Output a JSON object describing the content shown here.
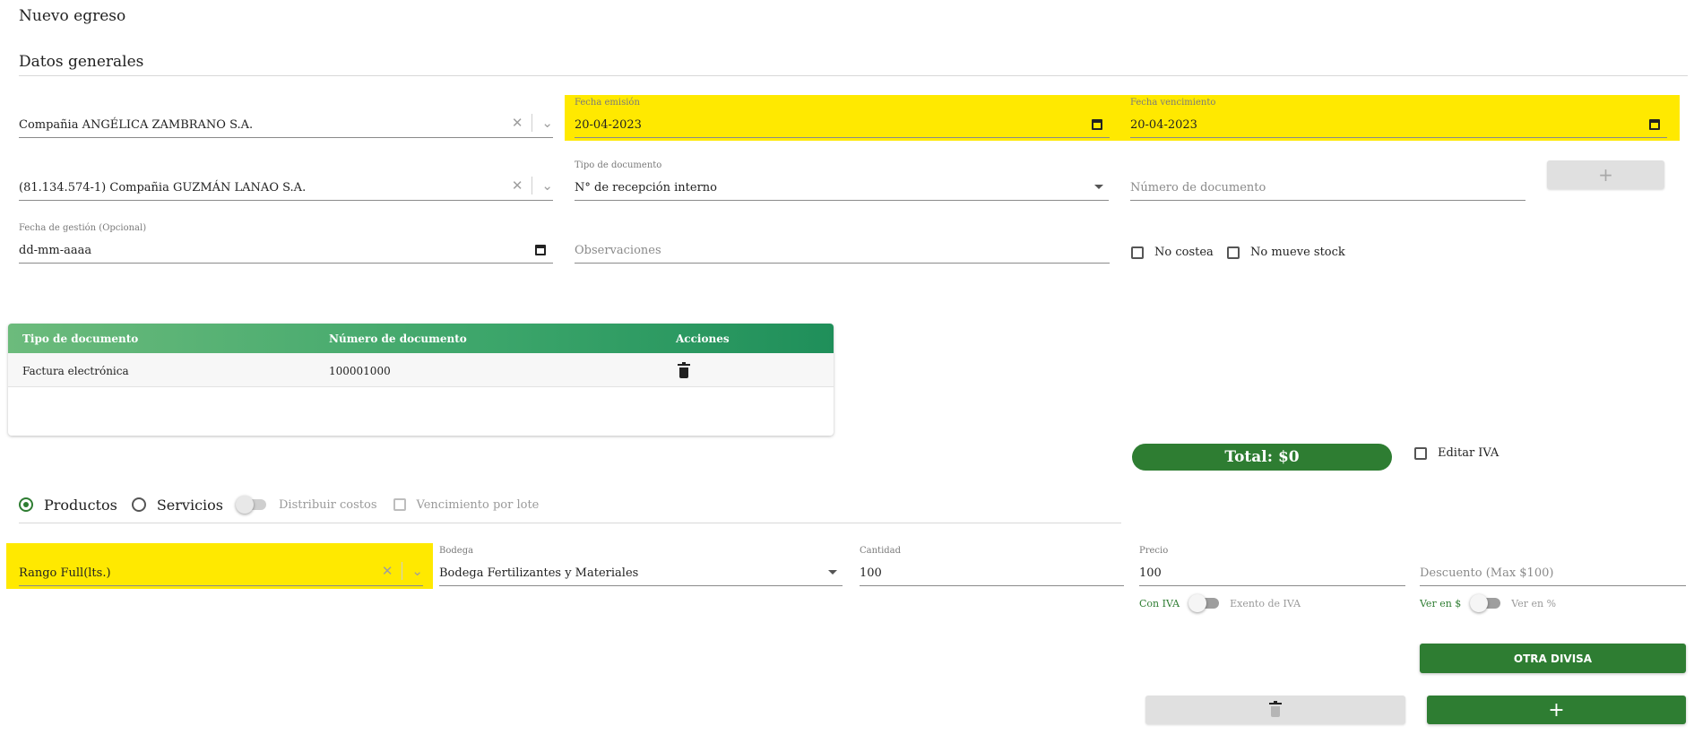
{
  "page": {
    "title": "Nuevo egreso",
    "section": "Datos generales"
  },
  "company": {
    "value": "Compañia ANGÉLICA ZAMBRANO S.A."
  },
  "fecha_emision": {
    "label": "Fecha emisión",
    "value": "20-04-2023"
  },
  "fecha_vencimiento": {
    "label": "Fecha vencimiento",
    "value": "20-04-2023"
  },
  "provider": {
    "value": "(81.134.574-1) Compañia GUZMÁN LANAO S.A."
  },
  "tipo_documento": {
    "label": "Tipo de documento",
    "value": "N° de recepción interno"
  },
  "numero_documento": {
    "placeholder": "Número de documento"
  },
  "add_doc_button": {
    "label": "+"
  },
  "fecha_gestion": {
    "label": "Fecha de gestión (Opcional)",
    "value": "dd-mm-aaaa"
  },
  "observaciones": {
    "placeholder": "Observaciones"
  },
  "checkboxes": {
    "no_costea": "No costea",
    "no_mueve_stock": "No mueve stock",
    "editar_iva": "Editar IVA"
  },
  "doc_table": {
    "headers": [
      "Tipo de documento",
      "Número de documento",
      "Acciones"
    ],
    "rows": [
      {
        "tipo": "Factura electrónica",
        "numero": "100001000"
      }
    ]
  },
  "total": {
    "label": "Total: $0"
  },
  "item_type": {
    "productos": "Productos",
    "servicios": "Servicios",
    "distribuir_costos": "Distribuir costos",
    "vencimiento_por_lote": "Vencimiento por lote",
    "selected": "Productos"
  },
  "line": {
    "producto": {
      "value": "Rango Full(lts.)"
    },
    "bodega": {
      "label": "Bodega",
      "value": "Bodega Fertilizantes y Materiales"
    },
    "cantidad": {
      "label": "Cantidad",
      "value": "100"
    },
    "precio": {
      "label": "Precio",
      "value": "100"
    },
    "descuento": {
      "placeholder": "Descuento (Max $100)"
    },
    "con_iva": "Con IVA",
    "exento_iva": "Exento de IVA",
    "ver_pesos": "Ver en $",
    "ver_pct": "Ver en %"
  },
  "buttons": {
    "otra_divisa": "OTRA DIVISA",
    "add": "+"
  },
  "colors": {
    "primary_green": "#2e7d32",
    "highlight": "#ffe900",
    "table_header": "#3ba56a"
  }
}
